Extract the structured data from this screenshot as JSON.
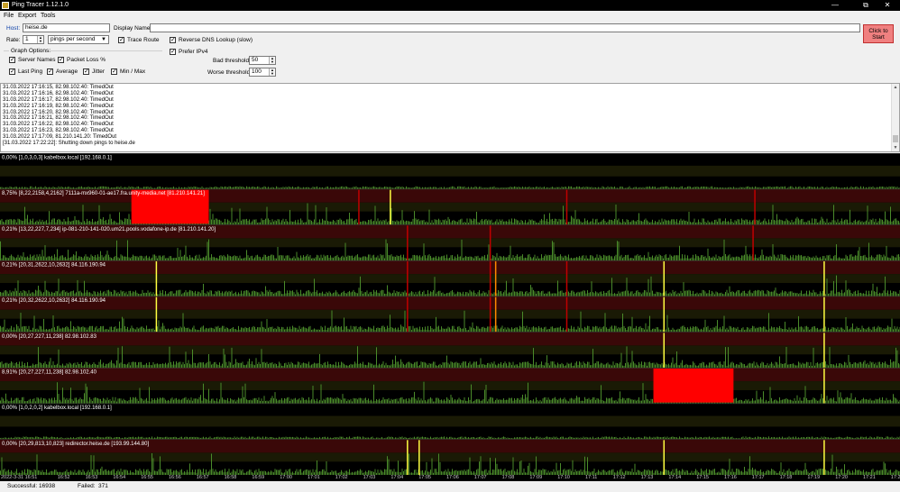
{
  "window": {
    "title": "Ping Tracer 1.12.1.0",
    "minimize": "—",
    "maximize": "⧉",
    "close": "✕"
  },
  "menu": [
    "File",
    "Export",
    "Tools"
  ],
  "form": {
    "host_label": "Host:",
    "host_value": "heise.de",
    "display_name_label": "Display Name:",
    "display_name_value": "",
    "rate_label": "Rate:",
    "rate_value": "1",
    "rate_unit": "pings per second",
    "trace_route_label": "Trace Route",
    "reverse_dns_label": "Reverse DNS Lookup (slow)",
    "prefer_ipv4_label": "Prefer IPv4",
    "graph_options_label": "Graph Options:",
    "server_names_label": "Server Names",
    "packet_loss_label": "Packet Loss %",
    "last_ping_label": "Last Ping",
    "average_label": "Average",
    "jitter_label": "Jitter",
    "min_max_label": "Min / Max",
    "bad_threshold_label": "Bad threshold:",
    "bad_threshold_value": "50",
    "worse_threshold_label": "Worse threshold:",
    "worse_threshold_value": "100",
    "start_button": "Click to Start"
  },
  "log_lines": [
    "31.03.2022 17:16:15, 82.98.102.40: TimedOut",
    "31.03.2022 17:16:16, 82.98.102.40: TimedOut",
    "31.03.2022 17:16:17, 82.98.102.40: TimedOut",
    "31.03.2022 17:16:19, 82.98.102.40: TimedOut",
    "31.03.2022 17:16:20, 82.98.102.40: TimedOut",
    "31.03.2022 17:16:21, 82.98.102.40: TimedOut",
    "31.03.2022 17:16:22, 82.98.102.40: TimedOut",
    "31.03.2022 17:16:23, 82.98.102.40: TimedOut",
    "31.03.2022 17:17:09, 81.210.141.20: TimedOut",
    "[31.03.2022 17:22:22]: Shutting down pings to heise.de"
  ],
  "graphs": [
    {
      "label": "0,00% [1,0,3,0,3] kabelbox.local [192.168.0.1]",
      "loss_blocks": [],
      "spikes": []
    },
    {
      "label": "8,75% [8,22,2158,4,2162] 7111a-mx960-01-ae17.fra.unity-media.net [81.210.141.21]",
      "loss_blocks": [
        [
          0.146,
          0.232
        ]
      ],
      "spikes": [
        [
          0.433,
          "y"
        ],
        [
          0.398,
          "r"
        ],
        [
          0.629,
          "r"
        ],
        [
          0.838,
          "r"
        ]
      ]
    },
    {
      "label": "0,21% [13,22,227,7,234] ip-081-210-141-020.um21.pools.vodafone-ip.de [81.210.141.20]",
      "loss_blocks": [],
      "spikes": [
        [
          0.452,
          "r"
        ],
        [
          0.544,
          "r"
        ],
        [
          0.836,
          "r"
        ]
      ]
    },
    {
      "label": "0,21% [20,31,2622,10,2632] 84.116.190.94",
      "loss_blocks": [],
      "spikes": [
        [
          0.173,
          "y"
        ],
        [
          0.452,
          "r"
        ],
        [
          0.544,
          "r"
        ],
        [
          0.55,
          "o"
        ],
        [
          0.629,
          "r"
        ],
        [
          0.737,
          "y"
        ],
        [
          0.915,
          "y"
        ]
      ]
    },
    {
      "label": "0,21% [20,32,2622,10,2632] 84.116.190.94",
      "loss_blocks": [],
      "spikes": [
        [
          0.173,
          "y"
        ],
        [
          0.452,
          "r"
        ],
        [
          0.544,
          "r"
        ],
        [
          0.55,
          "o"
        ],
        [
          0.629,
          "r"
        ],
        [
          0.737,
          "y"
        ],
        [
          0.915,
          "y"
        ]
      ]
    },
    {
      "label": "0,00% [20,27,227,11,238] 82.98.102.83",
      "loss_blocks": [],
      "spikes": [
        [
          0.737,
          "y"
        ],
        [
          0.915,
          "y"
        ]
      ]
    },
    {
      "label": "8,91% [20,27,227,11,238] 82.98.102.40",
      "loss_blocks": [
        [
          0.726,
          0.815
        ]
      ],
      "spikes": [
        [
          0.915,
          "y"
        ]
      ]
    },
    {
      "label": "0,00% [1,0,2,0,2] kabelbox.local [192.168.0.1]",
      "loss_blocks": [],
      "spikes": []
    },
    {
      "label": "0,00% [20,29,813,10,823] redirector.heise.de [193.99.144.80]",
      "loss_blocks": [],
      "spikes": [
        [
          0.452,
          "y"
        ],
        [
          0.465,
          "y"
        ],
        [
          0.737,
          "y"
        ],
        [
          0.915,
          "y"
        ]
      ]
    }
  ],
  "time_labels": [
    "2022-3-31 16:51",
    "16:52",
    "16:53",
    "16:54",
    "16:55",
    "16:56",
    "16:57",
    "16:58",
    "16:59",
    "17:00",
    "17:01",
    "17:02",
    "17:03",
    "17:04",
    "17:05",
    "17:06",
    "17:07",
    "17:08",
    "17:09",
    "17:10",
    "17:11",
    "17:12",
    "17:13",
    "17:14",
    "17:15",
    "17:16",
    "17:17",
    "17:18",
    "17:19",
    "17:20",
    "17:21",
    "17:22"
  ],
  "status": {
    "successful_label": "Successful:",
    "successful_value": "16938",
    "failed_label": "Failed:",
    "failed_value": "371"
  },
  "colors": {
    "good_bar": "#4a8a2a",
    "bad_band": "#3a0808",
    "ok_band": "#1a1a05",
    "loss": "#ff0000",
    "spike_yellow": "#ffff40",
    "spike_red": "#c00000",
    "spike_orange": "#ff8800"
  }
}
